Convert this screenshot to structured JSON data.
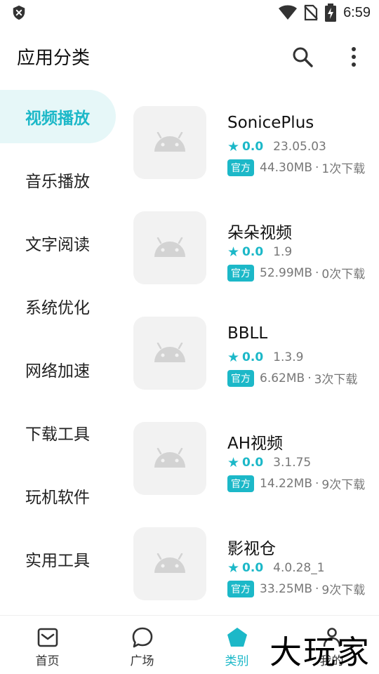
{
  "status_bar": {
    "time": "6:59",
    "icons": [
      "shield-icon",
      "wifi-icon",
      "no-sim-icon",
      "battery-charging-icon"
    ]
  },
  "app_bar": {
    "title": "应用分类",
    "actions": [
      "search-icon",
      "more-vert-icon"
    ]
  },
  "categories": [
    {
      "label": "视频播放",
      "active": true
    },
    {
      "label": "音乐播放",
      "active": false
    },
    {
      "label": "文字阅读",
      "active": false
    },
    {
      "label": "系统优化",
      "active": false
    },
    {
      "label": "网络加速",
      "active": false
    },
    {
      "label": "下载工具",
      "active": false
    },
    {
      "label": "玩机软件",
      "active": false
    },
    {
      "label": "实用工具",
      "active": false
    }
  ],
  "apps": [
    {
      "name": "SonicePlus",
      "rating": "0.0",
      "version": "23.05.03",
      "badge": "官方",
      "size": "44.30MB",
      "sep": "·",
      "downloads": "1次下载",
      "icon": "android-placeholder-icon"
    },
    {
      "name": "朵朵视频",
      "rating": "0.0",
      "version": "1.9",
      "badge": "官方",
      "size": "52.99MB",
      "sep": "·",
      "downloads": "0次下载",
      "icon": "android-placeholder-icon"
    },
    {
      "name": "BBLL",
      "rating": "0.0",
      "version": "1.3.9",
      "badge": "官方",
      "size": "6.62MB",
      "sep": "·",
      "downloads": "3次下载",
      "icon": "android-placeholder-icon"
    },
    {
      "name": "AH视频",
      "rating": "0.0",
      "version": "3.1.75",
      "badge": "官方",
      "size": "14.22MB",
      "sep": "·",
      "downloads": "9次下载",
      "icon": "android-placeholder-icon"
    },
    {
      "name": "影视仓",
      "rating": "0.0",
      "version": "4.0.28_1",
      "badge": "官方",
      "size": "33.25MB",
      "sep": "·",
      "downloads": "9次下载",
      "icon": "android-placeholder-icon"
    }
  ],
  "bottom_nav": [
    {
      "label": "首页",
      "icon": "inbox-icon",
      "active": false
    },
    {
      "label": "广场",
      "icon": "chat-bubble-icon",
      "active": false
    },
    {
      "label": "类别",
      "icon": "pentagon-icon",
      "active": true
    },
    {
      "label": "我的",
      "icon": "person-icon",
      "active": false
    }
  ],
  "watermark": "大玩家",
  "colors": {
    "accent": "#1cb8c8",
    "active_bg": "#e6f7f8",
    "icon_bg": "#f2f2f2"
  }
}
